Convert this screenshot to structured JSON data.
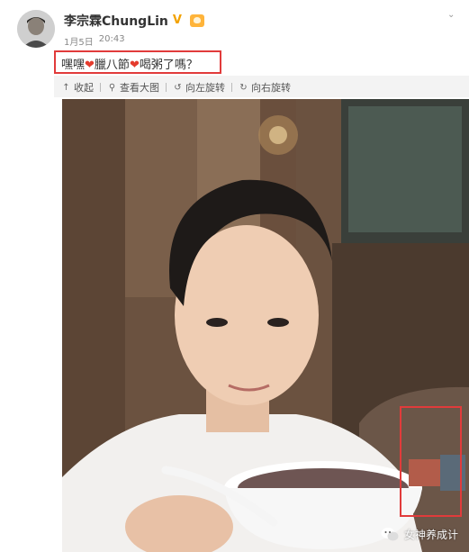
{
  "post": {
    "author": "李宗霖ChungLin",
    "date": "1月5日",
    "time": "20:43",
    "content": {
      "part1": "嘿嘿",
      "part2": "臘八節",
      "part3": "喝粥了嗎？"
    }
  },
  "toolbar": {
    "collapse_label": "收起",
    "view_large_label": "查看大图",
    "rotate_left_label": "向左旋转",
    "rotate_right_label": "向右旋转"
  },
  "icons": {
    "verified": "verified-v-icon",
    "fan_badge": "fan-badge-icon",
    "collapse": "up-arrow-icon",
    "view_large": "magnifier-icon",
    "rotate_left": "rotate-left-icon",
    "rotate_right": "rotate-right-icon",
    "more": "chevron-down-icon",
    "watermark": "wechat-icon"
  },
  "watermark": {
    "text": "女神养成计"
  },
  "colors": {
    "highlight_border": "#e13b3b",
    "verified_gold": "#f2a100",
    "heart_red": "#e43b2d"
  }
}
